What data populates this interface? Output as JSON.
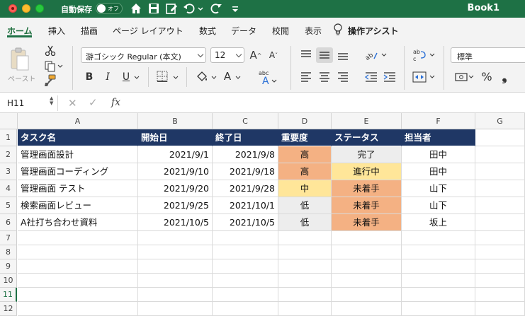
{
  "titlebar": {
    "autosave_label": "自動保存",
    "autosave_state": "オフ",
    "book_title": "Book1"
  },
  "ribbon_tabs": [
    "ホーム",
    "挿入",
    "描画",
    "ページ レイアウト",
    "数式",
    "データ",
    "校閲",
    "表示",
    "操作アシスト"
  ],
  "ribbon": {
    "paste_label": "ペースト",
    "font_name": "游ゴシック Regular (本文)",
    "font_size": "12",
    "grow_font": "A",
    "shrink_font": "A",
    "bold": "B",
    "italic": "I",
    "underline": "U",
    "font_color_glyph": "A",
    "number_format": "標準",
    "percent": "%",
    "comma": "❟"
  },
  "formula_bar": {
    "cell_ref": "H11",
    "fx_label": "fx",
    "formula": ""
  },
  "sheet": {
    "columns": [
      "A",
      "B",
      "C",
      "D",
      "E",
      "F",
      "G"
    ],
    "row_numbers": [
      "1",
      "2",
      "3",
      "4",
      "5",
      "6",
      "7",
      "8",
      "9",
      "10",
      "11",
      "12"
    ],
    "selected_row": "11",
    "header": [
      "タスク名",
      "開始日",
      "終了日",
      "重要度",
      "ステータス",
      "担当者"
    ],
    "rows": [
      {
        "task": "管理画面設計",
        "start": "2021/9/1",
        "end": "2021/9/8",
        "priority": "高",
        "status": "完了",
        "owner": "田中"
      },
      {
        "task": "管理画面コーディング",
        "start": "2021/9/10",
        "end": "2021/9/18",
        "priority": "高",
        "status": "進行中",
        "owner": "田中"
      },
      {
        "task": "管理画面 テスト",
        "start": "2021/9/20",
        "end": "2021/9/28",
        "priority": "中",
        "status": "未着手",
        "owner": "山下"
      },
      {
        "task": "検索画面レビュー",
        "start": "2021/9/25",
        "end": "2021/10/1",
        "priority": "低",
        "status": "未着手",
        "owner": "山下"
      },
      {
        "task": "A社打ち合わせ資料",
        "start": "2021/10/5",
        "end": "2021/10/5",
        "priority": "低",
        "status": "未着手",
        "owner": "坂上"
      }
    ]
  },
  "colors": {
    "excel_green": "#1e7145",
    "header_navy": "#1f3765",
    "high_orange": "#f4b183",
    "mid_yellow": "#ffe699",
    "low_gray": "#ededed"
  }
}
